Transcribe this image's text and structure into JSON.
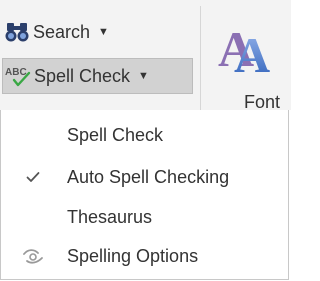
{
  "ribbon": {
    "search_label": "Search",
    "spell_check_label": "Spell Check",
    "font_label": "Font"
  },
  "menu": {
    "items": [
      {
        "label": "Spell Check",
        "checked": false,
        "icon": ""
      },
      {
        "label": "Auto Spell Checking",
        "checked": true,
        "icon": "checkmark-icon"
      },
      {
        "label": "Thesaurus",
        "checked": false,
        "icon": ""
      },
      {
        "label": "Spelling Options",
        "checked": false,
        "icon": "spelling-options-icon"
      }
    ]
  },
  "colors": {
    "ribbon_bg": "#f3f3f3",
    "selected_button_bg": "#d2d2d2",
    "text": "#333333",
    "font_icon_blue": "#3b6fc9"
  }
}
